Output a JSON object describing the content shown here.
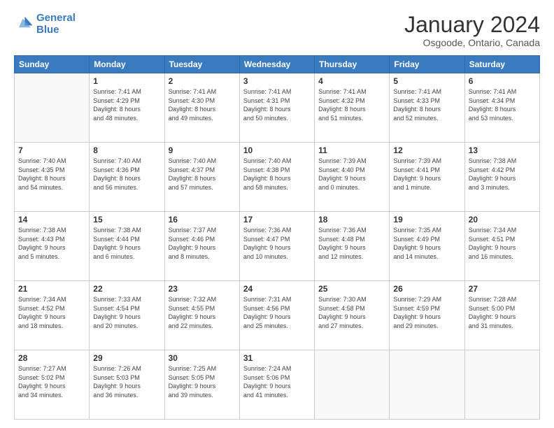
{
  "header": {
    "logo_line1": "General",
    "logo_line2": "Blue",
    "title": "January 2024",
    "subtitle": "Osgoode, Ontario, Canada"
  },
  "weekdays": [
    "Sunday",
    "Monday",
    "Tuesday",
    "Wednesday",
    "Thursday",
    "Friday",
    "Saturday"
  ],
  "weeks": [
    [
      {
        "day": "",
        "info": ""
      },
      {
        "day": "1",
        "info": "Sunrise: 7:41 AM\nSunset: 4:29 PM\nDaylight: 8 hours\nand 48 minutes."
      },
      {
        "day": "2",
        "info": "Sunrise: 7:41 AM\nSunset: 4:30 PM\nDaylight: 8 hours\nand 49 minutes."
      },
      {
        "day": "3",
        "info": "Sunrise: 7:41 AM\nSunset: 4:31 PM\nDaylight: 8 hours\nand 50 minutes."
      },
      {
        "day": "4",
        "info": "Sunrise: 7:41 AM\nSunset: 4:32 PM\nDaylight: 8 hours\nand 51 minutes."
      },
      {
        "day": "5",
        "info": "Sunrise: 7:41 AM\nSunset: 4:33 PM\nDaylight: 8 hours\nand 52 minutes."
      },
      {
        "day": "6",
        "info": "Sunrise: 7:41 AM\nSunset: 4:34 PM\nDaylight: 8 hours\nand 53 minutes."
      }
    ],
    [
      {
        "day": "7",
        "info": "Sunrise: 7:40 AM\nSunset: 4:35 PM\nDaylight: 8 hours\nand 54 minutes."
      },
      {
        "day": "8",
        "info": "Sunrise: 7:40 AM\nSunset: 4:36 PM\nDaylight: 8 hours\nand 56 minutes."
      },
      {
        "day": "9",
        "info": "Sunrise: 7:40 AM\nSunset: 4:37 PM\nDaylight: 8 hours\nand 57 minutes."
      },
      {
        "day": "10",
        "info": "Sunrise: 7:40 AM\nSunset: 4:38 PM\nDaylight: 8 hours\nand 58 minutes."
      },
      {
        "day": "11",
        "info": "Sunrise: 7:39 AM\nSunset: 4:40 PM\nDaylight: 9 hours\nand 0 minutes."
      },
      {
        "day": "12",
        "info": "Sunrise: 7:39 AM\nSunset: 4:41 PM\nDaylight: 9 hours\nand 1 minute."
      },
      {
        "day": "13",
        "info": "Sunrise: 7:38 AM\nSunset: 4:42 PM\nDaylight: 9 hours\nand 3 minutes."
      }
    ],
    [
      {
        "day": "14",
        "info": "Sunrise: 7:38 AM\nSunset: 4:43 PM\nDaylight: 9 hours\nand 5 minutes."
      },
      {
        "day": "15",
        "info": "Sunrise: 7:38 AM\nSunset: 4:44 PM\nDaylight: 9 hours\nand 6 minutes."
      },
      {
        "day": "16",
        "info": "Sunrise: 7:37 AM\nSunset: 4:46 PM\nDaylight: 9 hours\nand 8 minutes."
      },
      {
        "day": "17",
        "info": "Sunrise: 7:36 AM\nSunset: 4:47 PM\nDaylight: 9 hours\nand 10 minutes."
      },
      {
        "day": "18",
        "info": "Sunrise: 7:36 AM\nSunset: 4:48 PM\nDaylight: 9 hours\nand 12 minutes."
      },
      {
        "day": "19",
        "info": "Sunrise: 7:35 AM\nSunset: 4:49 PM\nDaylight: 9 hours\nand 14 minutes."
      },
      {
        "day": "20",
        "info": "Sunrise: 7:34 AM\nSunset: 4:51 PM\nDaylight: 9 hours\nand 16 minutes."
      }
    ],
    [
      {
        "day": "21",
        "info": "Sunrise: 7:34 AM\nSunset: 4:52 PM\nDaylight: 9 hours\nand 18 minutes."
      },
      {
        "day": "22",
        "info": "Sunrise: 7:33 AM\nSunset: 4:54 PM\nDaylight: 9 hours\nand 20 minutes."
      },
      {
        "day": "23",
        "info": "Sunrise: 7:32 AM\nSunset: 4:55 PM\nDaylight: 9 hours\nand 22 minutes."
      },
      {
        "day": "24",
        "info": "Sunrise: 7:31 AM\nSunset: 4:56 PM\nDaylight: 9 hours\nand 25 minutes."
      },
      {
        "day": "25",
        "info": "Sunrise: 7:30 AM\nSunset: 4:58 PM\nDaylight: 9 hours\nand 27 minutes."
      },
      {
        "day": "26",
        "info": "Sunrise: 7:29 AM\nSunset: 4:59 PM\nDaylight: 9 hours\nand 29 minutes."
      },
      {
        "day": "27",
        "info": "Sunrise: 7:28 AM\nSunset: 5:00 PM\nDaylight: 9 hours\nand 31 minutes."
      }
    ],
    [
      {
        "day": "28",
        "info": "Sunrise: 7:27 AM\nSunset: 5:02 PM\nDaylight: 9 hours\nand 34 minutes."
      },
      {
        "day": "29",
        "info": "Sunrise: 7:26 AM\nSunset: 5:03 PM\nDaylight: 9 hours\nand 36 minutes."
      },
      {
        "day": "30",
        "info": "Sunrise: 7:25 AM\nSunset: 5:05 PM\nDaylight: 9 hours\nand 39 minutes."
      },
      {
        "day": "31",
        "info": "Sunrise: 7:24 AM\nSunset: 5:06 PM\nDaylight: 9 hours\nand 41 minutes."
      },
      {
        "day": "",
        "info": ""
      },
      {
        "day": "",
        "info": ""
      },
      {
        "day": "",
        "info": ""
      }
    ]
  ]
}
